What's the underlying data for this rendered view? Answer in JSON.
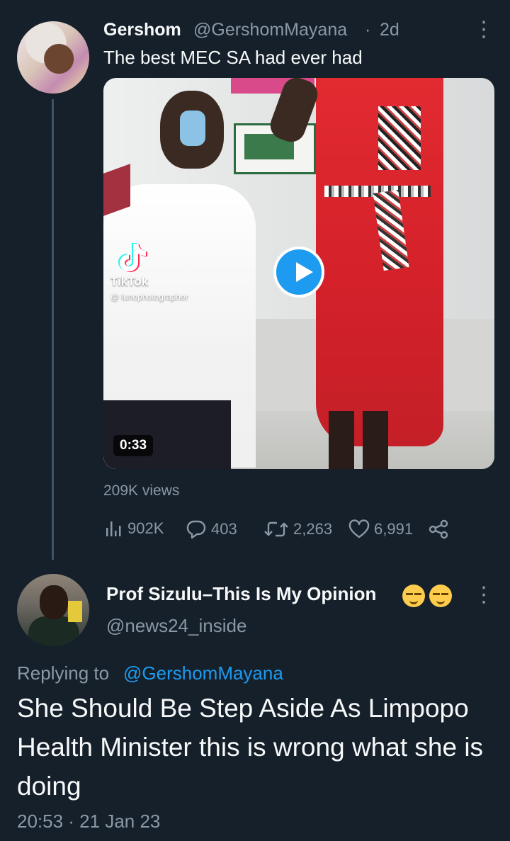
{
  "tweet1": {
    "author_name": "Gershom",
    "handle": "@GershomMayana",
    "separator": "·",
    "age": "2d",
    "more": "⋮",
    "text": "The best MEC SA had ever had",
    "media": {
      "watermark_brand": "TikTok",
      "watermark_user": "@ lunophotographer",
      "duration": "0:33"
    },
    "views": "209K views",
    "stats": {
      "analytics": "902K",
      "replies": "403",
      "retweets": "2,263",
      "likes": "6,991"
    }
  },
  "tweet2": {
    "author_name": "Prof Sizulu–This Is My Opinion",
    "handle": "@news24_inside",
    "more": "⋮",
    "replying_label": "Replying to",
    "replying_handle": "@GershomMayana",
    "text": "She Should Be Step Aside As Limpopo Health Minister this is wrong what she is doing",
    "timestamp": "20:53 · 21 Jan 23"
  },
  "colors": {
    "background": "#15202b",
    "accent": "#1d9bf0",
    "secondary_text": "#8b98a5",
    "primary_text": "#f7f9f9"
  }
}
